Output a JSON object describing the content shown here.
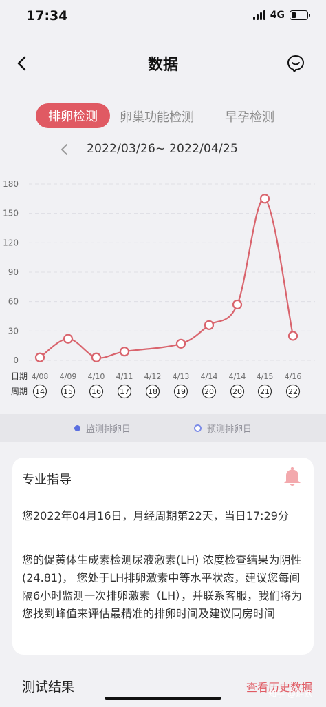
{
  "status": {
    "time": "17:34",
    "network": "4G"
  },
  "nav": {
    "title": "数据",
    "back_icon": "chevron-left-icon",
    "support_icon": "smile-chat-icon"
  },
  "tabs": [
    {
      "label": "排卵检测",
      "active": true
    },
    {
      "label": "卵巢功能检测",
      "active": false
    },
    {
      "label": "早孕检测",
      "active": false
    }
  ],
  "date_range": "2022/03/26~ 2022/04/25",
  "chart_data": {
    "type": "line",
    "y_ticks": [
      0,
      30,
      60,
      90,
      120,
      150,
      180
    ],
    "ylim": [
      0,
      180
    ],
    "row_labels": {
      "date": "日期",
      "cycle": "周期"
    },
    "x": [
      "4/08",
      "4/09",
      "4/10",
      "4/11",
      "4/12",
      "4/13",
      "4/14",
      "4/14",
      "4/15",
      "4/16"
    ],
    "cycle_days": [
      "14",
      "15",
      "16",
      "17",
      "18",
      "19",
      "20",
      "20",
      "21",
      "22"
    ],
    "point_values": [
      3,
      22,
      3,
      9,
      null,
      17,
      36,
      57,
      165,
      25
    ],
    "grid": "dashed horizontal",
    "line_color": "#d9646d",
    "point_color": "#d9646d"
  },
  "legend": {
    "monitor": "监测排卵日",
    "predict": "预测排卵日"
  },
  "guidance": {
    "title": "专业指导",
    "bell_icon": "bell-icon",
    "paragraph1": "您2022年04月16日，月经周期第22天，当日17:29分",
    "paragraph2": "您的促黄体生成素检测尿液激素(LH) 浓度检查结果为阴性(24.81)， 您处于LH排卵激素中等水平状态，建议您每间隔6小时监测一次排卵激素（LH），并联系客服，我们将为您找到峰值来评估最精准的排卵时间及建议同房时间"
  },
  "results": {
    "title": "测试结果",
    "history_link": "查看历史数据"
  },
  "watermark": "知乎 @瑶默"
}
